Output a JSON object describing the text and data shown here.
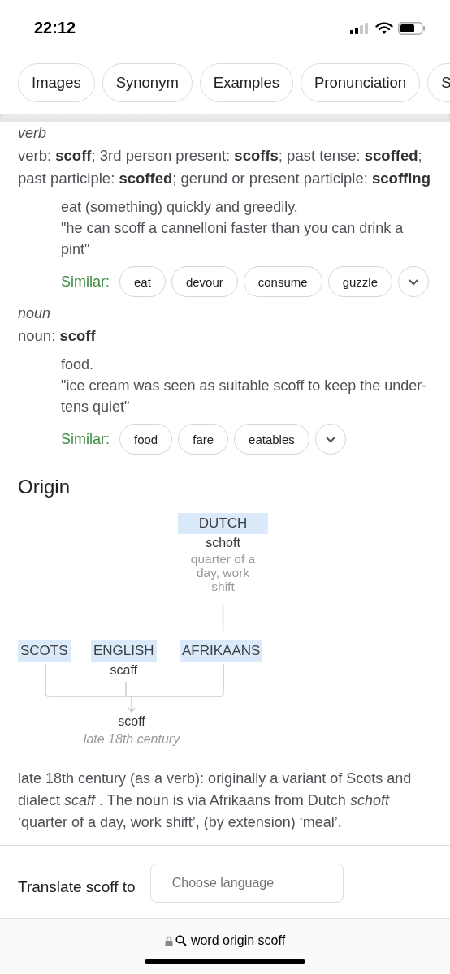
{
  "status_bar": {
    "time": "22:12"
  },
  "chips": [
    {
      "label": "Images"
    },
    {
      "label": "Synonym"
    },
    {
      "label": "Examples"
    },
    {
      "label": "Pronunciation"
    },
    {
      "label": "S"
    }
  ],
  "senses": [
    {
      "part_of_speech": "verb",
      "forms": "verb: **scoff**; 3rd person present: **scoffs**; past tense: **scoffed**; past participle: **scoffed**; gerund or present participle: **scoffing**",
      "definition": {
        "before": "eat (something) quickly and",
        "link": "greedily",
        "after": "."
      },
      "example": "\"he can scoff a cannelloni faster than you can drink a pint\"",
      "similar_label": "Similar:",
      "similar": [
        "eat",
        "devour",
        "consume",
        "guzzle"
      ]
    },
    {
      "part_of_speech": "noun",
      "forms": "noun: **scoff**",
      "definition": {
        "before": "food."
      },
      "example": "\"ice cream was seen as suitable scoff to keep the under-tens quiet\"",
      "similar_label": "Similar:",
      "similar": [
        "food",
        "fare",
        "eatables"
      ]
    }
  ],
  "origin": {
    "heading": "Origin",
    "diagram": {
      "ancestor": {
        "language": "DUTCH",
        "word": "schoft",
        "gloss": "quarter of a day, work shift"
      },
      "sources": [
        {
          "language": "SCOTS"
        },
        {
          "language": "ENGLISH",
          "word": "scaff"
        },
        {
          "language": "AFRIKAANS"
        }
      ],
      "result": {
        "word": "scoff",
        "date": "late 18th century"
      }
    },
    "text": "late 18th century (as a verb): originally a variant of Scots and dialect *scaff* . The noun is via Afrikaans from Dutch *schoft* ‘quarter of a day, work shift’, (by extension) ‘meal’."
  },
  "translate": {
    "label": "Translate scoff to",
    "placeholder": "Choose language"
  },
  "address_bar": {
    "text": "word origin scoff"
  }
}
